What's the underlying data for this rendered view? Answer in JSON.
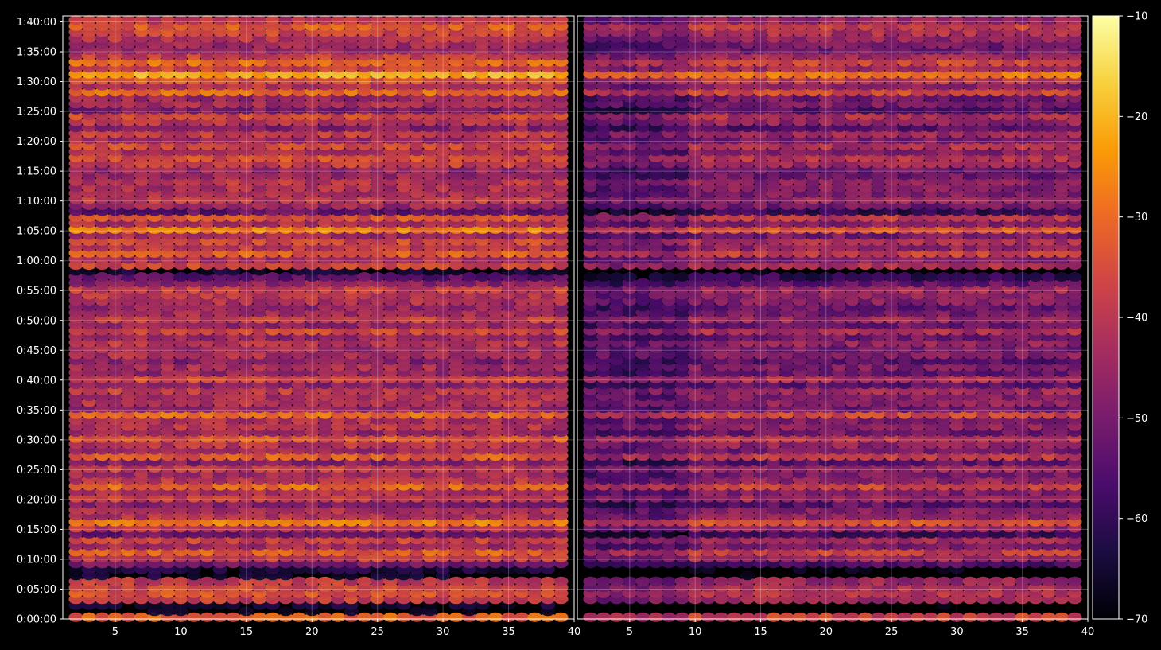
{
  "chart_data": {
    "type": "heatmap",
    "title": "",
    "xlabel": "",
    "ylabel": "",
    "background": "#000000",
    "colormap": "inferno",
    "colormap_stops": [
      "#000004",
      "#1b0c41",
      "#4a0c6b",
      "#781c6d",
      "#a52c60",
      "#cf4446",
      "#ed6925",
      "#fb9b06",
      "#f7d13d",
      "#fcffa4"
    ],
    "grid": true,
    "colorbar": {
      "position": "right",
      "range": [
        -70,
        -10
      ],
      "ticks": [
        -10,
        -20,
        -30,
        -40,
        -50,
        -60,
        -70
      ],
      "tick_labels": [
        "−10",
        "−20",
        "−30",
        "−40",
        "−50",
        "−60",
        "−70"
      ]
    },
    "panels": [
      {
        "name": "left",
        "xlim": [
          1,
          40
        ],
        "xticks": [
          5,
          10,
          15,
          20,
          25,
          30,
          35,
          40
        ],
        "x_tick_labels": [
          "5",
          "10",
          "15",
          "20",
          "25",
          "30",
          "35",
          "40"
        ],
        "intensity_offset": 0
      },
      {
        "name": "right",
        "xlim": [
          1,
          40
        ],
        "xticks": [
          5,
          10,
          15,
          20,
          25,
          30,
          35,
          40
        ],
        "x_tick_labels": [
          "5",
          "10",
          "15",
          "20",
          "25",
          "30",
          "35",
          "40"
        ],
        "intensity_offset": -6
      }
    ],
    "ylim_seconds": [
      0,
      6060
    ],
    "yticks_seconds": [
      0,
      300,
      600,
      900,
      1200,
      1500,
      1800,
      2100,
      2400,
      2700,
      3000,
      3300,
      3600,
      3900,
      4200,
      4500,
      4800,
      5100,
      5400,
      5700,
      6000
    ],
    "y_tick_labels": [
      "0:00:00",
      "0:05:00",
      "0:10:00",
      "0:15:00",
      "0:20:00",
      "0:25:00",
      "0:30:00",
      "0:35:00",
      "0:40:00",
      "0:45:00",
      "0:50:00",
      "0:55:00",
      "1:00:00",
      "1:05:00",
      "1:10:00",
      "1:15:00",
      "1:20:00",
      "1:25:00",
      "1:30:00",
      "1:35:00",
      "1:40:00"
    ],
    "row_interval_seconds": 60,
    "columns_per_panel": 38,
    "row_levels_dB": [
      -31,
      -68,
      -66,
      -38,
      -34,
      -36,
      -39,
      -66,
      -64,
      -50,
      -38,
      -32,
      -44,
      -37,
      -52,
      -40,
      -27,
      -41,
      -42,
      -48,
      -38,
      -42,
      -30,
      -40,
      -44,
      -38,
      -48,
      -32,
      -44,
      -40,
      -33,
      -45,
      -40,
      -42,
      -30,
      -45,
      -41,
      -42,
      -38,
      -47,
      -36,
      -46,
      -43,
      -48,
      -42,
      -44,
      -40,
      -45,
      -36,
      -46,
      -38,
      -44,
      -46,
      -42,
      -40,
      -38,
      -47,
      -54,
      -66,
      -36,
      -43,
      -32,
      -40,
      -36,
      -44,
      -27,
      -42,
      -33,
      -54,
      -44,
      -39,
      -43,
      -42,
      -40,
      -45,
      -46,
      -38,
      -35,
      -42,
      -36,
      -44,
      -38,
      -48,
      -40,
      -36,
      -49,
      -43,
      -45,
      -30,
      -40,
      -33,
      -21,
      -37,
      -30,
      -38,
      -45,
      -44,
      -40,
      -36,
      -32,
      -40
    ]
  }
}
